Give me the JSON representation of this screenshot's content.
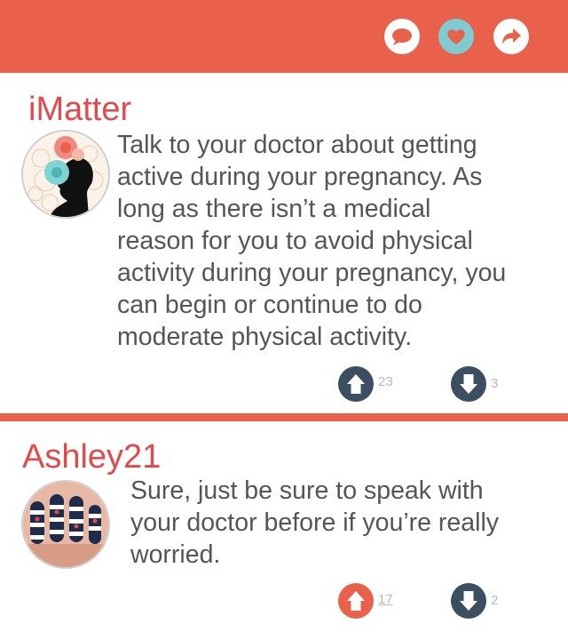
{
  "toolbar": {
    "comment_icon": "speech-bubble-icon",
    "favorite_icon": "heart-icon",
    "share_icon": "share-arrow-icon",
    "bar_color": "#e9614a",
    "favorite_bg": "#7ecbd1"
  },
  "posts": [
    {
      "username": "iMatter",
      "avatar": "woman-silhouette-flowers",
      "lines": [
        "Talk to your doctor about getting",
        "active during your pregnancy. As",
        "long as there isn’t a medical",
        "reason for you to avoid physical",
        "activity during your pregnancy, you",
        "can begin or continue to do",
        "moderate physical activity."
      ],
      "upvotes": "23",
      "downvotes": "3",
      "upvoted": false
    },
    {
      "username": "Ashley21",
      "avatar": "striped-nail-art",
      "lines": [
        "Sure, just be sure to speak with",
        "your doctor before if you’re really",
        "worried."
      ],
      "upvotes": "17",
      "downvotes": "2",
      "upvoted": true
    }
  ],
  "colors": {
    "accent": "#e9614a",
    "username": "#e04a4a",
    "vote_dark": "#3b4f60",
    "text": "#555555",
    "count": "#b8b8b8"
  }
}
